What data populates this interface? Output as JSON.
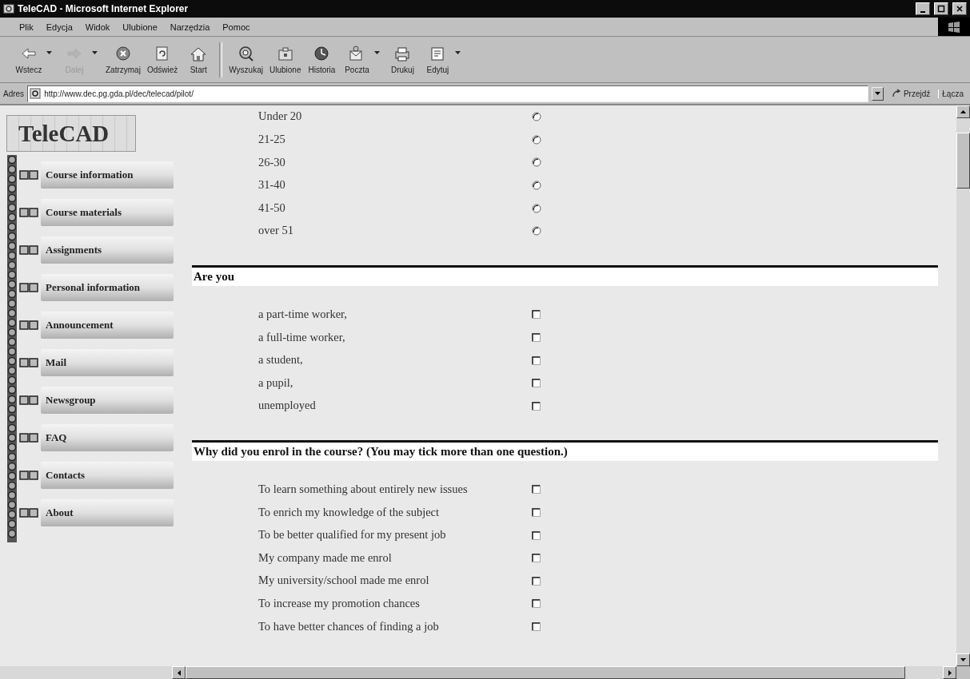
{
  "window": {
    "title": "TeleCAD - Microsoft Internet Explorer"
  },
  "menu": [
    "Plik",
    "Edycja",
    "Widok",
    "Ulubione",
    "Narzędzia",
    "Pomoc"
  ],
  "toolbar": [
    {
      "kind": "back",
      "label": "Wstecz",
      "disabled": false,
      "dropdown": true
    },
    {
      "kind": "forward",
      "label": "Dalej",
      "disabled": true,
      "dropdown": true
    },
    {
      "kind": "stop",
      "label": "Zatrzymaj",
      "disabled": false,
      "dropdown": false
    },
    {
      "kind": "refresh",
      "label": "Odśwież",
      "disabled": false,
      "dropdown": false
    },
    {
      "kind": "home",
      "label": "Start",
      "disabled": false,
      "dropdown": false
    },
    {
      "kind": "search",
      "label": "Wyszukaj",
      "disabled": false,
      "dropdown": false
    },
    {
      "kind": "favorites",
      "label": "Ulubione",
      "disabled": false,
      "dropdown": false
    },
    {
      "kind": "history",
      "label": "Historia",
      "disabled": false,
      "dropdown": false
    },
    {
      "kind": "mail",
      "label": "Poczta",
      "disabled": false,
      "dropdown": true
    },
    {
      "kind": "print",
      "label": "Drukuj",
      "disabled": false,
      "dropdown": false
    },
    {
      "kind": "edit",
      "label": "Edytuj",
      "disabled": false,
      "dropdown": true
    }
  ],
  "address": {
    "label": "Adres",
    "value": "http://www.dec.pg.gda.pl/dec/telecad/pilot/",
    "go": "Przejdź",
    "links": "Łącza"
  },
  "sidebar": {
    "logo": "TeleCAD",
    "items": [
      {
        "label": "Course information"
      },
      {
        "label": "Course materials"
      },
      {
        "label": "Assignments"
      },
      {
        "label": "Personal information"
      },
      {
        "label": "Announcement"
      },
      {
        "label": "Mail"
      },
      {
        "label": "Newsgroup"
      },
      {
        "label": "FAQ"
      },
      {
        "label": "Contacts"
      },
      {
        "label": "About"
      }
    ]
  },
  "sections": [
    {
      "kind": "radio",
      "options": [
        {
          "label": "Under 20",
          "selected": false
        },
        {
          "label": "21-25",
          "selected": false
        },
        {
          "label": "26-30",
          "selected": false
        },
        {
          "label": "31-40",
          "selected": false
        },
        {
          "label": "41-50",
          "selected": false
        },
        {
          "label": "over 51",
          "selected": false
        }
      ]
    },
    {
      "kind": "checkbox",
      "heading": "Are you",
      "options": [
        {
          "label": "a part-time worker,",
          "checked": false
        },
        {
          "label": "a full-time worker,",
          "checked": false
        },
        {
          "label": "a student,",
          "checked": false
        },
        {
          "label": "a pupil,",
          "checked": false
        },
        {
          "label": "unemployed",
          "checked": false
        }
      ]
    },
    {
      "kind": "checkbox",
      "heading": "Why did you enrol in the course? (You may tick more than one question.)",
      "options": [
        {
          "label": "To learn something about entirely new issues",
          "checked": false
        },
        {
          "label": "To enrich my knowledge of the subject",
          "checked": false
        },
        {
          "label": "To be better qualified for my present job",
          "checked": false
        },
        {
          "label": "My company made me enrol",
          "checked": false
        },
        {
          "label": "My university/school made me enrol",
          "checked": false
        },
        {
          "label": "To increase my promotion chances",
          "checked": false
        },
        {
          "label": "To have better chances of finding a job",
          "checked": false
        }
      ]
    }
  ]
}
